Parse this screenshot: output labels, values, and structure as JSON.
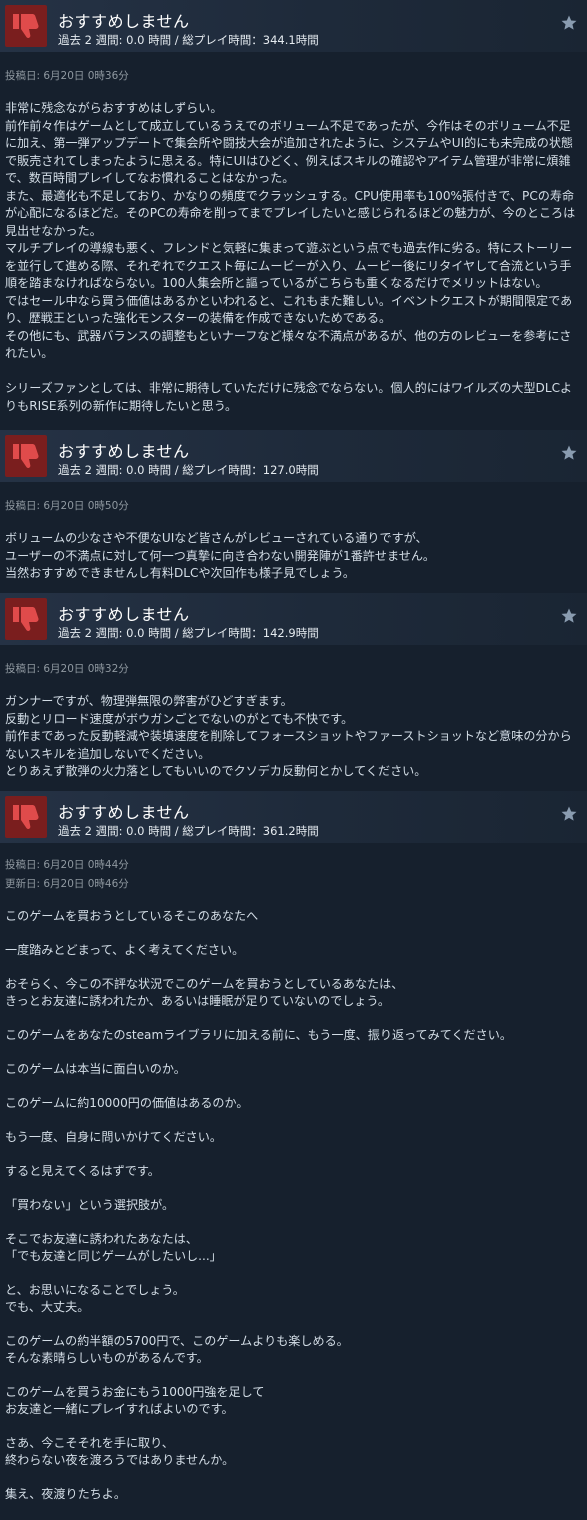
{
  "reviews": [
    {
      "verdict": "おすすめしません",
      "hours": "過去 2 週間: 0.0 時間 / 総プレイ時間：344.1時間",
      "posted": "投稿日: 6月20日 0時36分",
      "body": "非常に残念ながらおすすめはしずらい。\n前作前々作はゲームとして成立しているうえでのボリューム不足であったが、今作はそのボリューム不足に加え、第一弾アップデートで集会所や闘技大会が追加されたように、システムやUI的にも未完成の状態で販売されてしまったように思える。特にUIはひどく、例えばスキルの確認やアイテム管理が非常に煩雑で、数百時間プレイしてなお慣れることはなかった。\nまた、最適化も不足しており、かなりの頻度でクラッシュする。CPU使用率も100%張付きで、PCの寿命が心配になるほどだ。そのPCの寿命を削ってまでプレイしたいと感じられるほどの魅力が、今のところは見出せなかった。\nマルチプレイの導線も悪く、フレンドと気軽に集まって遊ぶという点でも過去作に劣る。特にストーリーを並行して進める際、それぞれでクエスト毎にムービーが入り、ムービー後にリタイヤして合流という手順を踏まなければならない。100人集会所と謳っているがこちらも重くなるだけでメリットはない。\nではセール中なら買う価値はあるかといわれると、これもまた難しい。イベントクエストが期間限定であり、歴戦王といった強化モンスターの装備を作成できないためである。\nその他にも、武器バランスの調整もといナーフなど様々な不満点があるが、他の方のレビューを参考にされたい。\n\nシリーズファンとしては、非常に期待していただけに残念でならない。個人的にはワイルズの大型DLCよりもRISE系列の新作に期待したいと思う。"
    },
    {
      "verdict": "おすすめしません",
      "hours": "過去 2 週間: 0.0 時間 / 総プレイ時間：127.0時間",
      "posted": "投稿日: 6月20日 0時50分",
      "body": "ボリュームの少なさや不便なUIなど皆さんがレビューされている通りですが、\nユーザーの不満点に対して何一つ真摯に向き合わない開発陣が1番許せません。\n当然おすすめできませんし有料DLCや次回作も様子見でしょう。"
    },
    {
      "verdict": "おすすめしません",
      "hours": "過去 2 週間: 0.0 時間 / 総プレイ時間：142.9時間",
      "posted": "投稿日: 6月20日 0時32分",
      "body": "ガンナーですが、物理弾無限の弊害がひどすぎます。\n反動とリロード速度がボウガンごとでないのがとても不快です。\n前作まであった反動軽減や装填速度を削除してフォースショットやファーストショットなど意味の分からないスキルを追加しないでください。\nとりあえず散弾の火力落としてもいいのでクソデカ反動何とかしてください。"
    },
    {
      "verdict": "おすすめしません",
      "hours": "過去 2 週間: 0.0 時間 / 総プレイ時間：361.2時間",
      "posted": "投稿日: 6月20日 0時44分",
      "updated": "更新日: 6月20日 0時46分",
      "body": "このゲームを買おうとしているそこのあなたへ\n\n一度踏みとどまって、よく考えてください。\n\nおそらく、今この不評な状況でこのゲームを買おうとしているあなたは、\nきっとお友達に誘われたか、あるいは睡眠が足りていないのでしょう。\n\nこのゲームをあなたのsteamライブラリに加える前に、もう一度、振り返ってみてください。\n\nこのゲームは本当に面白いのか。\n\nこのゲームに約10000円の価値はあるのか。\n\nもう一度、自身に問いかけてください。\n\nすると見えてくるはずです。\n\n「買わない」という選択肢が。\n\nそこでお友達に誘われたあなたは、\n「でも友達と同じゲームがしたいし...」\n\nと、お思いになることでしょう。\nでも、大丈夫。\n\nこのゲームの約半額の5700円で、このゲームよりも楽しめる。\nそんな素晴らしいものがあるんです。\n\nこのゲームを買うお金にもう1000円強を足して\nお友達と一緒にプレイすればよいのです。\n\nさあ、今こそそれを手に取り、\n終わらない夜を渡ろうではありませんか。\n\n集え、夜渡りたちよ。"
    }
  ],
  "icons": {
    "verdict": "thumbs-down-icon",
    "award": "star-icon"
  },
  "colors": {
    "thumb_bg": "#7a1e1e",
    "thumb_fg": "#e04b4b",
    "page_bg": "#1b2838"
  }
}
